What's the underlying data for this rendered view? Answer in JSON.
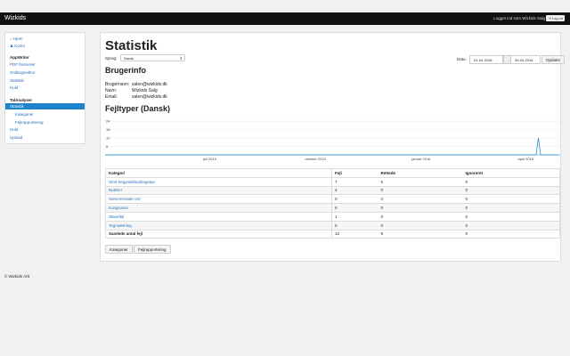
{
  "topbar": {
    "brand": "Wizkids",
    "user_text": "Logget ind som Wizkids Salg",
    "logout": "Log ud"
  },
  "sidebar": {
    "home": "Hjem",
    "account": "Konto",
    "appwriter_header": "AppWriter",
    "appwriter_items": [
      "PDF fremviser",
      "Ordbogseditor",
      "Statistik",
      "Hold"
    ],
    "tal_header": "TalAnalyser",
    "tal_items": [
      "Statistik",
      "Kategorier",
      "Fejlrapportering",
      "Hold",
      "Upload"
    ]
  },
  "main": {
    "title": "Statistik",
    "language_label": "Sprog:",
    "language_value": "Dansk",
    "date_label": "Dato:",
    "date_from": "01-04-2016",
    "date_sep": "-",
    "date_to": "30-04-2016",
    "update_button": "Opdater",
    "userinfo_title": "Brugerinfo",
    "userinfo": [
      {
        "label": "Brugernavn:",
        "value": "salen@wizkids.dk"
      },
      {
        "label": "Navn:",
        "value": "Wizkids Salg"
      },
      {
        "label": "Email:",
        "value": "salen@wizkids.dk"
      }
    ],
    "chart_title": "Fejltyper (Dansk)",
    "table_headers": [
      "Kategori",
      "Fejl",
      "Rettede",
      "Ignoreret"
    ],
    "rows": [
      [
        "Stort begyndelsesbogstav",
        "7",
        "6",
        "0"
      ],
      [
        "Nutids-r",
        "4",
        "0",
        "0"
      ],
      [
        "Sammensatte ord",
        "0",
        "3",
        "0"
      ],
      [
        "Kongruens",
        "0",
        "0",
        "0"
      ],
      [
        "Stavefejl",
        "1",
        "0",
        "0"
      ],
      [
        "Tegnsætning",
        "0",
        "0",
        "0"
      ]
    ],
    "total": [
      "Samlede antal fejl",
      "12",
      "9",
      "0"
    ],
    "buttons": [
      "Kategorier",
      "Fejlrapportering"
    ]
  },
  "chart_data": {
    "type": "line",
    "yticks": [
      24,
      18,
      12,
      6
    ],
    "xticks": [
      "juli 2015",
      "oktober 2015",
      "januar 2016",
      "april 2016"
    ],
    "ylim": [
      0,
      26
    ],
    "series": [
      {
        "x": [
          "2015-04-01",
          "2016-04-10",
          "2016-04-12",
          "2016-04-14",
          "2016-04-30"
        ],
        "values": [
          0,
          0,
          12,
          0,
          0
        ]
      }
    ],
    "color": "#1e8fd6",
    "grid": true
  },
  "footer": "© Wizkids A/S"
}
